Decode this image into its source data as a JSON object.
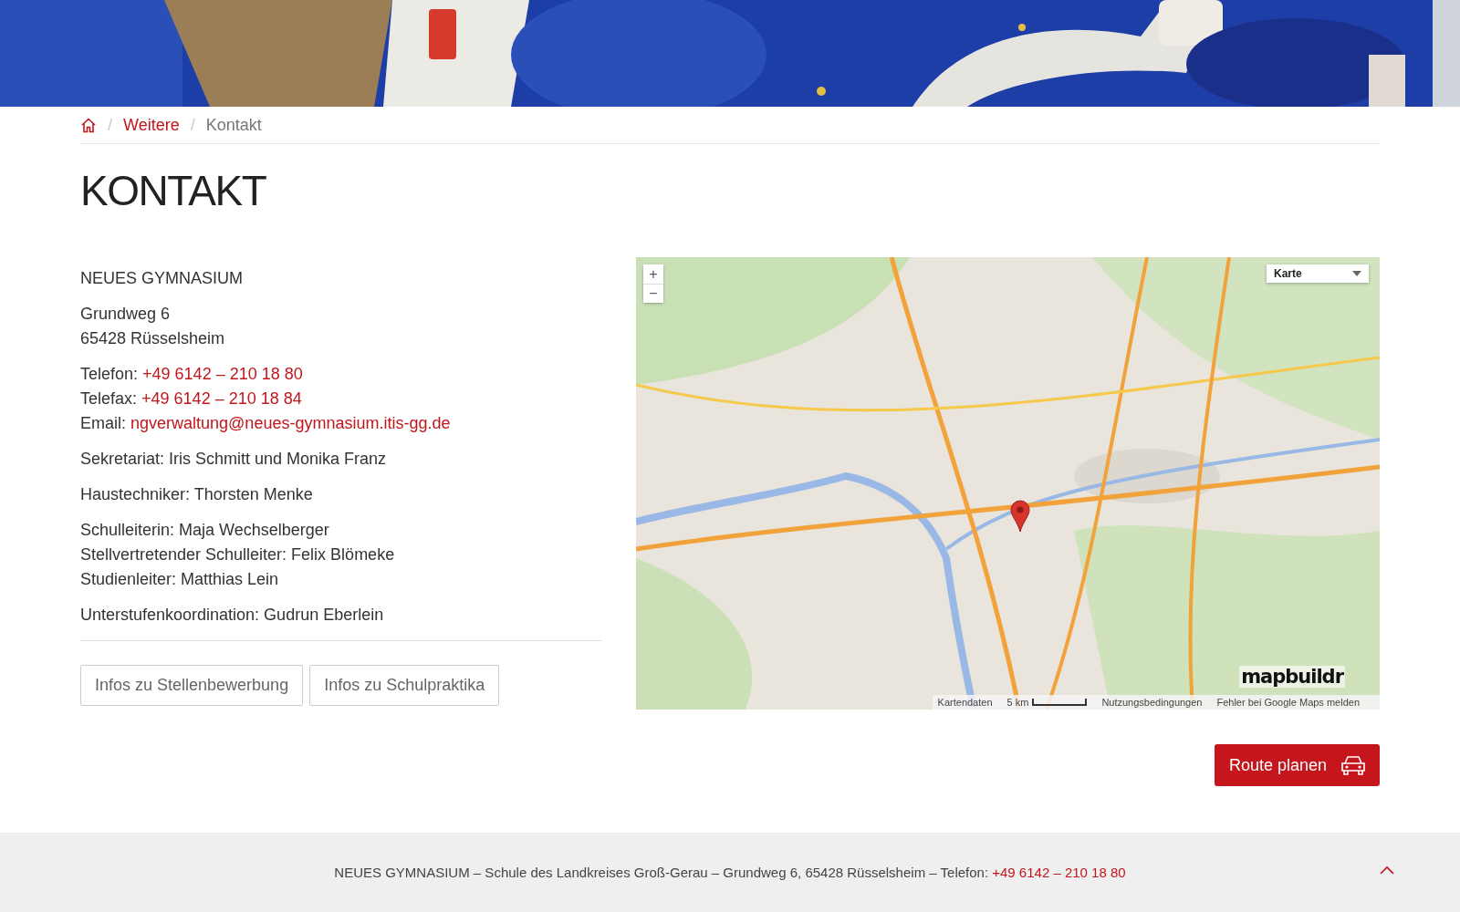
{
  "breadcrumb": [
    {
      "kind": "home"
    },
    {
      "kind": "separator",
      "label": "/"
    },
    {
      "kind": "link",
      "label": "Weitere"
    },
    {
      "kind": "separator",
      "label": "/"
    },
    {
      "kind": "current",
      "label": "Kontakt"
    }
  ],
  "title": "KONTAKT",
  "contact": [
    {
      "lines": [
        {
          "text": "NEUES GYMNASIUM"
        }
      ]
    },
    {
      "lines": [
        {
          "text": "Grundweg 6"
        },
        {
          "text": "65428 Rüsselsheim"
        }
      ]
    },
    {
      "lines": [
        {
          "text": "Telefon:",
          "link": "+49 6142 – 210 18 80"
        },
        {
          "text": "Telefax:",
          "link": "+49 6142 – 210 18 84"
        },
        {
          "text": "Email:",
          "link": "ngverwaltung@neues-gymnasium.itis-gg.de"
        }
      ]
    },
    {
      "lines": [
        {
          "text": "Sekretariat: Iris Schmitt und Monika Franz"
        }
      ]
    },
    {
      "lines": [
        {
          "text": "Haustechniker: Thorsten Menke"
        }
      ]
    },
    {
      "lines": [
        {
          "text": "Schulleiterin: Maja Wechselberger"
        },
        {
          "text": "Stellvertretender Schulleiter: Felix Blömeke"
        },
        {
          "text": "Studienleiter: Matthias Lein"
        }
      ]
    },
    {
      "lines": [
        {
          "text": "Unterstufenkoordination: Gudrun Eberlein"
        }
      ]
    }
  ],
  "buttons": [
    "Infos zu Stellenbewerbung",
    "Infos zu Schulpraktika"
  ],
  "map": {
    "zoom_in": "+",
    "zoom_out": "−",
    "map_type": "Karte",
    "brand": "mapbuildr",
    "footer": [
      "Kartendaten",
      "5 km",
      "Nutzungsbedingungen",
      "Fehler bei Google Maps melden"
    ]
  },
  "route_button": "Route planen",
  "footer": {
    "text": "NEUES GYMNASIUM – Schule des Landkreises Groß-Gerau – Grundweg 6, 65428 Rüsselsheim – Telefon:",
    "phone": "+49 6142 – 210 18 80"
  }
}
